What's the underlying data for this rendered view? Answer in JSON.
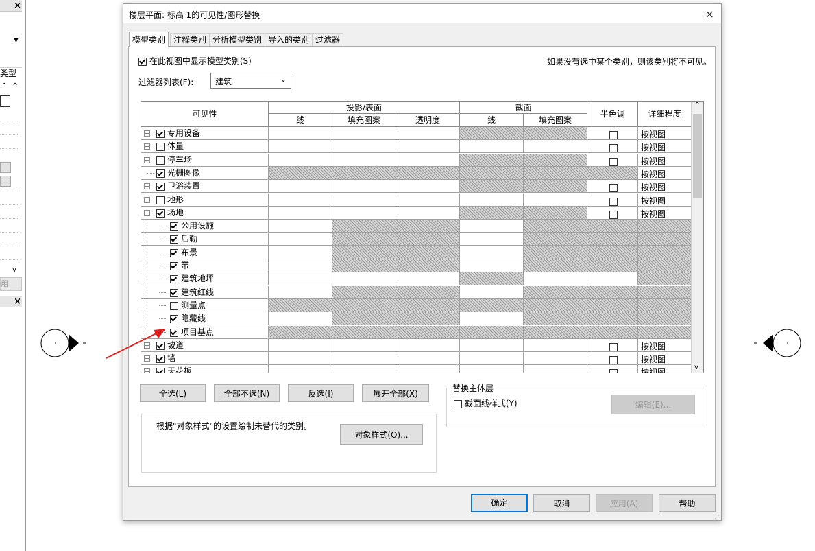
{
  "dialog": {
    "title": "楼层平面: 标高 1的可见性/图形替换",
    "close": "×"
  },
  "tabs": [
    {
      "label": "模型类别",
      "active": true
    },
    {
      "label": "注释类别"
    },
    {
      "label": "分析模型类别"
    },
    {
      "label": "导入的类别"
    },
    {
      "label": "过滤器"
    }
  ],
  "show_model_categories": {
    "label": "在此视图中显示模型类别(S)",
    "checked": true
  },
  "hint": "如果没有选中某个类别，则该类别将不可见。",
  "filter": {
    "label": "过滤器列表(F):",
    "value": "建筑"
  },
  "table": {
    "headers": {
      "visibility": "可见性",
      "projection": "投影/表面",
      "section": "截面",
      "halftone": "半色调",
      "detail": "详细程度",
      "line": "线",
      "fill": "填充图案",
      "transparency": "透明度",
      "sec_line": "线",
      "sec_fill": "填充图案"
    },
    "rows": [
      {
        "name": "专用设备",
        "level": 0,
        "expand": "+",
        "checked": true,
        "detail": "按视图",
        "halftone": true
      },
      {
        "name": "体量",
        "level": 0,
        "expand": "+",
        "checked": false,
        "detail": "按视图",
        "halftone": true
      },
      {
        "name": "停车场",
        "level": 0,
        "expand": "+",
        "checked": false,
        "detail": "按视图",
        "halftone": true
      },
      {
        "name": "光栅图像",
        "level": 0,
        "expand": "",
        "checked": true,
        "detail": "按视图",
        "halftone": false
      },
      {
        "name": "卫浴装置",
        "level": 0,
        "expand": "+",
        "checked": true,
        "detail": "按视图",
        "halftone": true
      },
      {
        "name": "地形",
        "level": 0,
        "expand": "+",
        "checked": false,
        "detail": "按视图",
        "halftone": true
      },
      {
        "name": "场地",
        "level": 0,
        "expand": "-",
        "checked": true,
        "detail": "按视图",
        "halftone": true
      },
      {
        "name": "公用设施",
        "level": 1,
        "checked": true,
        "detail": "",
        "halftone": false
      },
      {
        "name": "后勤",
        "level": 1,
        "checked": true,
        "detail": "",
        "halftone": false
      },
      {
        "name": "布景",
        "level": 1,
        "checked": true,
        "detail": "",
        "halftone": false
      },
      {
        "name": "带",
        "level": 1,
        "checked": true,
        "detail": "",
        "halftone": false
      },
      {
        "name": "建筑地坪",
        "level": 1,
        "checked": true,
        "detail": "",
        "halftone": false
      },
      {
        "name": "建筑红线",
        "level": 1,
        "checked": true,
        "detail": "",
        "halftone": false
      },
      {
        "name": "测量点",
        "level": 1,
        "checked": false,
        "detail": "",
        "halftone": false
      },
      {
        "name": "隐藏线",
        "level": 1,
        "checked": true,
        "detail": "",
        "halftone": false
      },
      {
        "name": "项目基点",
        "level": 1,
        "checked": true,
        "detail": "",
        "halftone": false
      },
      {
        "name": "坡道",
        "level": 0,
        "expand": "+",
        "checked": true,
        "detail": "按视图",
        "halftone": true
      },
      {
        "name": "墙",
        "level": 0,
        "expand": "+",
        "checked": true,
        "detail": "按视图",
        "halftone": true
      },
      {
        "name": "天花板",
        "level": 0,
        "expand": "+",
        "checked": true,
        "detail": "按视图",
        "halftone": true
      }
    ]
  },
  "buttons": {
    "select_all": "全选(L)",
    "select_none": "全部不选(N)",
    "invert": "反选(I)",
    "expand_all": "展开全部(X)",
    "object_styles": "对象样式(O)...",
    "edit": "编辑(E)...",
    "ok": "确定",
    "cancel": "取消",
    "apply": "应用(A)",
    "help": "帮助"
  },
  "note": "根据\"对象样式\"的设置绘制未替代的类别。",
  "host_layers": {
    "title": "替换主体层",
    "cut_line_styles": "截面线样式(Y)",
    "checked": false
  },
  "left_panel": {
    "close1": "×",
    "close2": "×",
    "type_label": "类型",
    "apply_label": "用"
  },
  "colors": {
    "arrow": "#e02020",
    "accent": "#0078d7"
  }
}
